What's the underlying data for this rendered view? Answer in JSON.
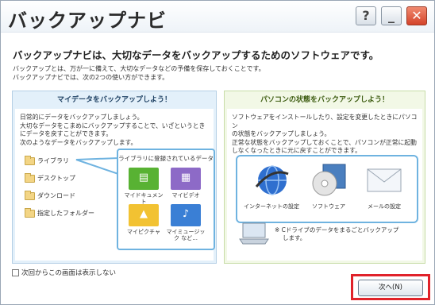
{
  "window": {
    "title": "バックアップナビ"
  },
  "titlebar_buttons": {
    "help": "?",
    "minimize": "_",
    "close": "✕"
  },
  "intro": {
    "headline": "バックアップナビは、大切なデータをバックアップするためのソフトウェアです。",
    "line1": "バックアップとは、万が一に備えて、大切なデータなどの予備を保存しておくことです。",
    "line2": "バックアップナビでは、次の2つの使い方ができます。"
  },
  "left_panel": {
    "heading": "マイデータをバックアップしよう！",
    "text": [
      "日常的にデータをバックアップしましょう。",
      "大切なデータをこまめにバックアップすることで、いざというとき",
      "にデータを戻すことができます。",
      "次のようなデータをバックアップします。"
    ],
    "items": [
      "ライブラリ",
      "デスクトップ",
      "ダウンロード",
      "指定したフォルダー"
    ],
    "library_title": "ライブラリに登録されているデータ",
    "library_items": [
      "マイドキュメント",
      "マイビデオ",
      "マイピクチャ",
      "マイミュージック など..."
    ]
  },
  "right_panel": {
    "heading": "パソコンの状態をバックアップしよう！",
    "text": [
      "ソフトウェアをインストールしたり、設定を変更したときにパソコン",
      "の状態をバックアップしましょう。",
      "正常な状態をバックアップしておくことで、パソコンが正常に起動",
      "しなくなったときに元に戻すことができます。"
    ],
    "items": [
      "インターネットの設定",
      "ソフトウェア",
      "メールの設定"
    ],
    "note": [
      "※ Cドライブのデータをまるごとバックアップ",
      "します。"
    ]
  },
  "checkbox_label": "次回からこの画面は表示しない",
  "next_button": "次へ(N)",
  "colors": {
    "accent_red": "#e0222a",
    "library_border": "#6fb3e0",
    "left_bg": "#e3f0fa",
    "right_bg": "#f2f8e6"
  }
}
